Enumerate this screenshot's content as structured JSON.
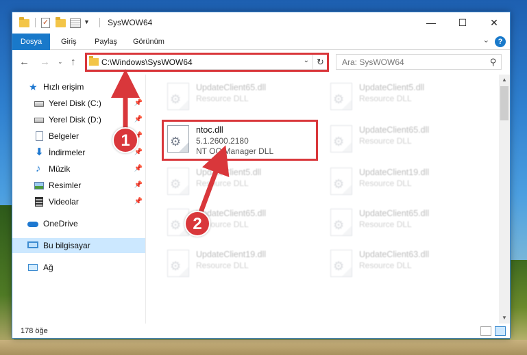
{
  "window": {
    "title": "SysWOW64",
    "controls": {
      "minimize": "—",
      "maximize": "☐",
      "close": "✕"
    }
  },
  "ribbon": {
    "tabs": [
      "Dosya",
      "Giriş",
      "Paylaş",
      "Görünüm"
    ],
    "help": "?"
  },
  "navigation": {
    "address": "C:\\Windows\\SysWOW64",
    "search_placeholder": "Ara: SysWOW64"
  },
  "sidebar": {
    "quick_access": "Hızlı erişim",
    "items": [
      {
        "label": "Yerel Disk (C:)",
        "icon": "drive-icon",
        "pinned": true
      },
      {
        "label": "Yerel Disk (D:)",
        "icon": "drive-icon",
        "pinned": true
      },
      {
        "label": "Belgeler",
        "icon": "documents-icon",
        "pinned": true
      },
      {
        "label": "İndirmeler",
        "icon": "downloads-icon",
        "pinned": true
      },
      {
        "label": "Müzik",
        "icon": "music-icon",
        "pinned": true
      },
      {
        "label": "Resimler",
        "icon": "pictures-icon",
        "pinned": true
      },
      {
        "label": "Videolar",
        "icon": "videos-icon",
        "pinned": true
      }
    ],
    "onedrive": "OneDrive",
    "this_pc": "Bu bilgisayar",
    "network": "Ağ"
  },
  "files": {
    "highlighted": {
      "name": "ntoc.dll",
      "version": "5.1.2600.2180",
      "description": "NT OC Manager DLL"
    },
    "left_column": [
      {
        "name": "UpdateClient65.dll",
        "description": "Resource DLL"
      },
      {
        "name": "UpdateClient5.dll",
        "description": "Resource DLL"
      },
      {
        "name": "UpdateClient65.dll",
        "description": "Resource DLL"
      },
      {
        "name": "UpdateClient19.dll",
        "description": "Resource DLL"
      }
    ],
    "right_column": [
      {
        "name": "UpdateClient5.dll",
        "description": "Resource DLL"
      },
      {
        "name": "UpdateClient65.dll",
        "description": "Resource DLL"
      },
      {
        "name": "UpdateClient19.dll",
        "description": "Resource DLL"
      },
      {
        "name": "UpdateClient65.dll",
        "description": "Resource DLL"
      },
      {
        "name": "UpdateClient63.dll",
        "description": "Resource DLL"
      }
    ]
  },
  "status": {
    "item_count": "178 öğe"
  },
  "annotations": {
    "step1": "1",
    "step2": "2",
    "color": "#d9373b"
  }
}
